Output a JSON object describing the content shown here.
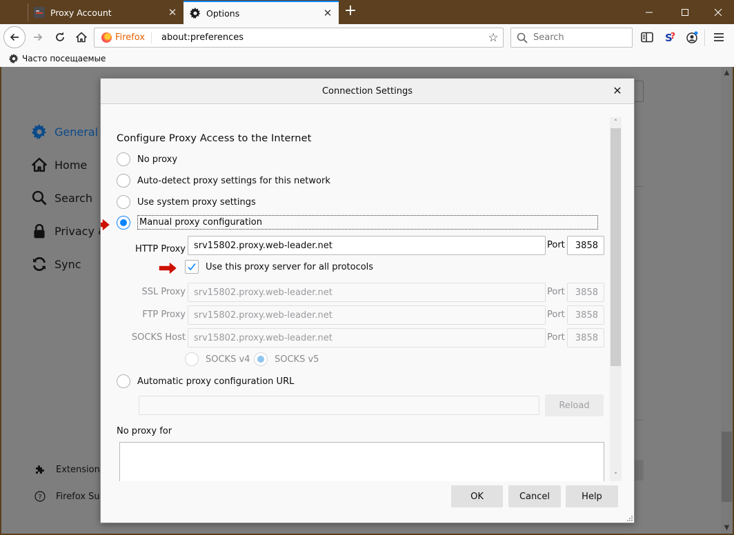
{
  "browser": {
    "tabs": [
      {
        "label": "Proxy Account",
        "active": false
      },
      {
        "label": "Options",
        "active": true
      }
    ],
    "new_tab_label": "+",
    "window_controls": {
      "minimize": "minimize-icon",
      "maximize": "maximize-icon",
      "close": "close-icon"
    },
    "identity_label": "Firefox",
    "url": "about:preferences",
    "search_placeholder": "Search",
    "bookmarks": [
      {
        "label": "Часто посещаемые",
        "icon": "gear-icon"
      }
    ],
    "accent_color": "#0a84ff"
  },
  "preferences": {
    "categories": [
      {
        "label": "General",
        "icon": "gear-icon",
        "selected": true
      },
      {
        "label": "Home",
        "icon": "home-icon"
      },
      {
        "label": "Search",
        "icon": "search-icon"
      },
      {
        "label": "Privacy & Security",
        "icon": "lock-icon"
      },
      {
        "label": "Sync",
        "icon": "sync-icon"
      }
    ],
    "footer_links": [
      {
        "label": "Extensions & Themes",
        "icon": "puzzle-icon"
      },
      {
        "label": "Firefox Support",
        "icon": "help-icon"
      }
    ]
  },
  "dialog": {
    "title": "Connection Settings",
    "section_title": "Configure Proxy Access to the Internet",
    "options": [
      {
        "label": "No proxy",
        "checked": false
      },
      {
        "label": "Auto-detect proxy settings for this network",
        "checked": false
      },
      {
        "label": "Use system proxy settings",
        "checked": false
      },
      {
        "label": "Manual proxy configuration",
        "checked": true
      }
    ],
    "http_proxy": {
      "label": "HTTP Proxy",
      "value": "srv15802.proxy.web-leader.net",
      "port_label": "Port",
      "port": "3858"
    },
    "use_for_all": {
      "label": "Use this proxy server for all protocols",
      "checked": true
    },
    "ssl_proxy": {
      "label": "SSL Proxy",
      "value": "srv15802.proxy.web-leader.net",
      "port_label": "Port",
      "port": "3858",
      "disabled": true
    },
    "ftp_proxy": {
      "label": "FTP Proxy",
      "value": "srv15802.proxy.web-leader.net",
      "port_label": "Port",
      "port": "3858",
      "disabled": true
    },
    "socks_host": {
      "label": "SOCKS Host",
      "value": "srv15802.proxy.web-leader.net",
      "port_label": "Port",
      "port": "3858",
      "disabled": true
    },
    "socks_versions": [
      {
        "label": "SOCKS v4",
        "checked": false
      },
      {
        "label": "SOCKS v5",
        "checked": true
      }
    ],
    "auto_config": {
      "label": "Automatic proxy configuration URL",
      "checked": false,
      "value": "",
      "reload_label": "Reload"
    },
    "no_proxy_for": {
      "label": "No proxy for",
      "value": ""
    },
    "buttons": {
      "ok": "OK",
      "cancel": "Cancel",
      "help": "Help"
    },
    "annotation_color": "#cc1100"
  }
}
